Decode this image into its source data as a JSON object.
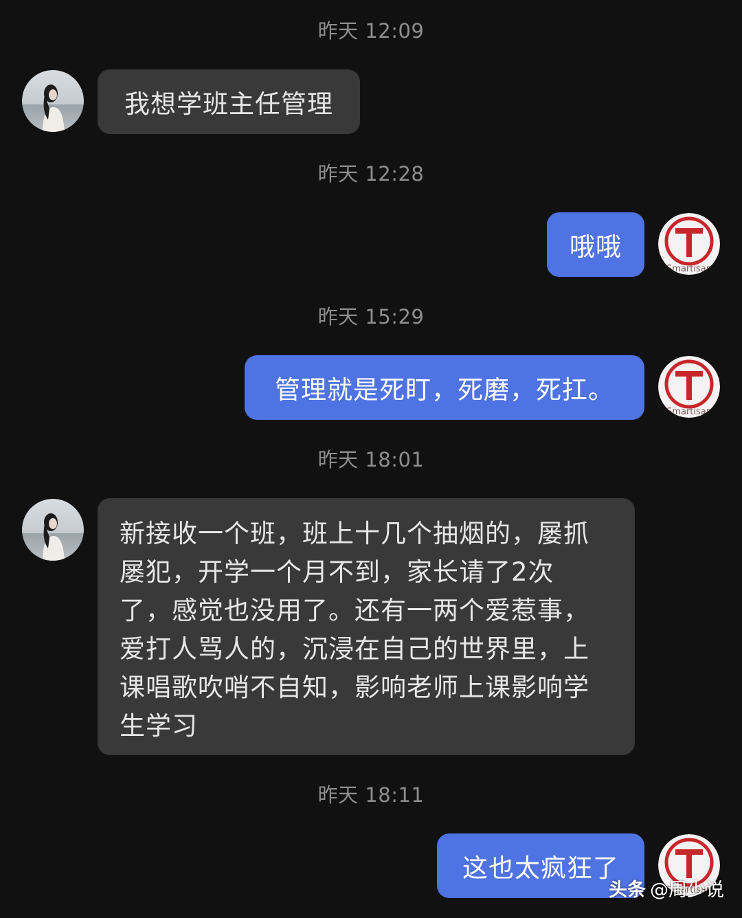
{
  "messages": [
    {
      "type": "timestamp",
      "text": "昨天 12:09"
    },
    {
      "type": "received",
      "text": "我想学班主任管理"
    },
    {
      "type": "timestamp",
      "text": "昨天 12:28"
    },
    {
      "type": "sent",
      "text": "哦哦"
    },
    {
      "type": "timestamp",
      "text": "昨天 15:29"
    },
    {
      "type": "sent",
      "text": "管理就是死盯，死磨，死扛。"
    },
    {
      "type": "timestamp",
      "text": "昨天 18:01"
    },
    {
      "type": "received",
      "lines": [
        "新接收一个班，班上十几个抽烟的，屡抓",
        "屡犯，开学一个月不到，家长请了2次",
        "了，感觉也没用了。还有一两个爱惹事，",
        "爱打人骂人的，沉浸在自己的世界里，上",
        "课唱歌吹哨不自知，影响老师上课影响学",
        "生学习"
      ]
    },
    {
      "type": "timestamp",
      "text": "昨天 18:11"
    },
    {
      "type": "sent",
      "text": "这也太疯狂了"
    }
  ],
  "avatars": {
    "self_icon": "smartisan-logo-icon",
    "self_logo_text": "Smartisan",
    "self_logo_letter": "T",
    "other_icon": "user-photo-avatar"
  },
  "watermark": {
    "brand": "头条",
    "account": "@周少说"
  },
  "colors": {
    "background": "#111111",
    "bubble_received": "#393939",
    "bubble_sent": "#4f73e2",
    "timestamp": "#8e8e8e",
    "logo_red": "#c8262a"
  }
}
